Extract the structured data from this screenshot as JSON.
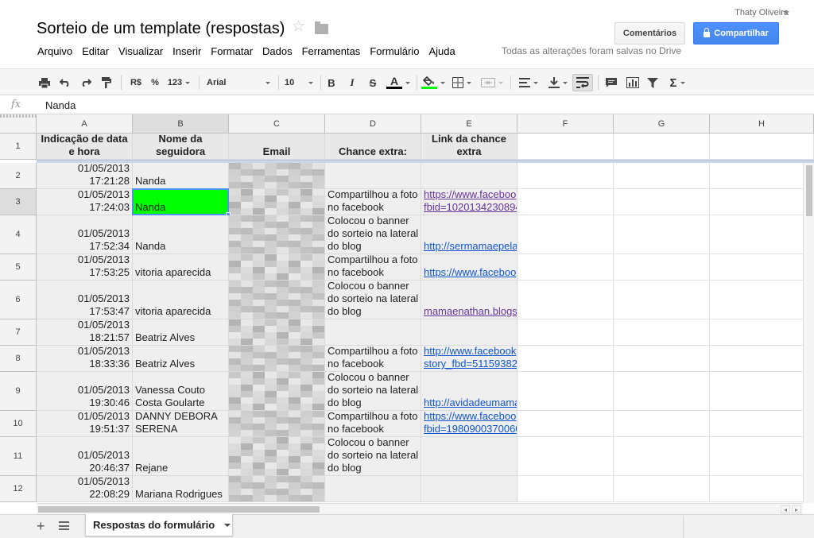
{
  "header": {
    "title": "Sorteio de um template (respostas)",
    "user": "Thaty Oliveira",
    "comments_label": "Comentários",
    "share_label": "Compartilhar",
    "save_status": "Todas as alterações foram salvas no Drive"
  },
  "menu": [
    "Arquivo",
    "Editar",
    "Visualizar",
    "Inserir",
    "Formatar",
    "Dados",
    "Ferramentas",
    "Formulário",
    "Ajuda"
  ],
  "toolbar": {
    "currency": "R$",
    "percent": "%",
    "number_format": "123",
    "font": "Arial",
    "font_size": "10",
    "bold": "B",
    "italic": "I",
    "strikethrough": "S",
    "text_color_letter": "A",
    "sum": "Σ",
    "colors": {
      "text_underline": "#000000",
      "fill_underline": "#00ff00"
    }
  },
  "formula_bar": {
    "fx": "fx",
    "value": "Nanda"
  },
  "sheet": {
    "columns": [
      "A",
      "B",
      "C",
      "D",
      "E",
      "F",
      "G",
      "H"
    ],
    "header_row": {
      "number": "1",
      "cells": [
        [
          "Indicação de data",
          "e hora"
        ],
        [
          "Nome da",
          "seguidora"
        ],
        [
          "Email"
        ],
        [
          "Chance extra:"
        ],
        [
          "Link da chance",
          "extra"
        ]
      ]
    },
    "rows": [
      {
        "number": "2",
        "date": "01/05/2013",
        "time": "17:21:28",
        "name": [
          "Nanda"
        ],
        "chance": [],
        "link": [],
        "link_visited": false
      },
      {
        "number": "3",
        "date": "01/05/2013",
        "time": "17:24:03",
        "name": [
          "Nanda"
        ],
        "chance": [
          "Compartilhou a foto",
          "no facebook"
        ],
        "link": [
          "https://www.faceboo",
          "fbid=1020134230894"
        ],
        "link_visited": true
      },
      {
        "number": "4",
        "date": "01/05/2013",
        "time": "17:52:34",
        "name": [
          "Nanda"
        ],
        "chance": [
          "Colocou o banner",
          "do sorteio na lateral",
          "do blog"
        ],
        "link": [
          "http://sermamaepela"
        ],
        "link_visited": false
      },
      {
        "number": "5",
        "date": "01/05/2013",
        "time": "17:53:25",
        "name": [
          "vitoria aparecida"
        ],
        "chance": [
          "Compartilhou a foto",
          "no facebook"
        ],
        "link": [
          "https://www.faceboo"
        ],
        "link_visited": false
      },
      {
        "number": "6",
        "date": "01/05/2013",
        "time": "17:53:47",
        "name": [
          "vitoria aparecida"
        ],
        "chance": [
          "Colocou o banner",
          "do sorteio na lateral",
          "do blog"
        ],
        "link": [
          "mamaenathan.blogs"
        ],
        "link_visited": true
      },
      {
        "number": "7",
        "date": "01/05/2013",
        "time": "18:21:57",
        "name": [
          "Beatriz Alves"
        ],
        "chance": [],
        "link": [],
        "link_visited": false
      },
      {
        "number": "8",
        "date": "01/05/2013",
        "time": "18:33:36",
        "name": [
          "Beatriz Alves"
        ],
        "chance": [
          "Compartilhou a foto",
          "no facebook"
        ],
        "link": [
          "http://www.facebook",
          "story_fbd=51159382"
        ],
        "link_visited": false
      },
      {
        "number": "9",
        "date": "01/05/2013",
        "time": "19:30:46",
        "name": [
          "Vanessa Couto",
          "Costa Goularte"
        ],
        "chance": [
          "Colocou o banner",
          "do sorteio na lateral",
          "do blog"
        ],
        "link": [
          "http://avidadeumama"
        ],
        "link_visited": false
      },
      {
        "number": "10",
        "date": "01/05/2013",
        "time": "19:51:37",
        "name": [
          "DANNY DEBORA",
          "SERENA"
        ],
        "chance": [
          "Compartilhou a foto",
          "no facebook"
        ],
        "link": [
          "https://www.faceboo",
          "fbid=1980900370060"
        ],
        "link_visited": false
      },
      {
        "number": "11",
        "date": "01/05/2013",
        "time": "20:46:37",
        "name": [
          "Rejane"
        ],
        "chance": [
          "Colocou o banner",
          "do sorteio na lateral",
          "do blog"
        ],
        "link": [],
        "link_visited": false
      },
      {
        "number": "12",
        "date": "01/05/2013",
        "time": "22:08:29",
        "name": [
          "Mariana Rodrigues"
        ],
        "chance": [],
        "link": [],
        "link_visited": false
      }
    ],
    "selected_cell": "B3",
    "selected_fill": "#00ff00"
  },
  "tabs": {
    "sheet_name": "Respostas do formulário"
  }
}
